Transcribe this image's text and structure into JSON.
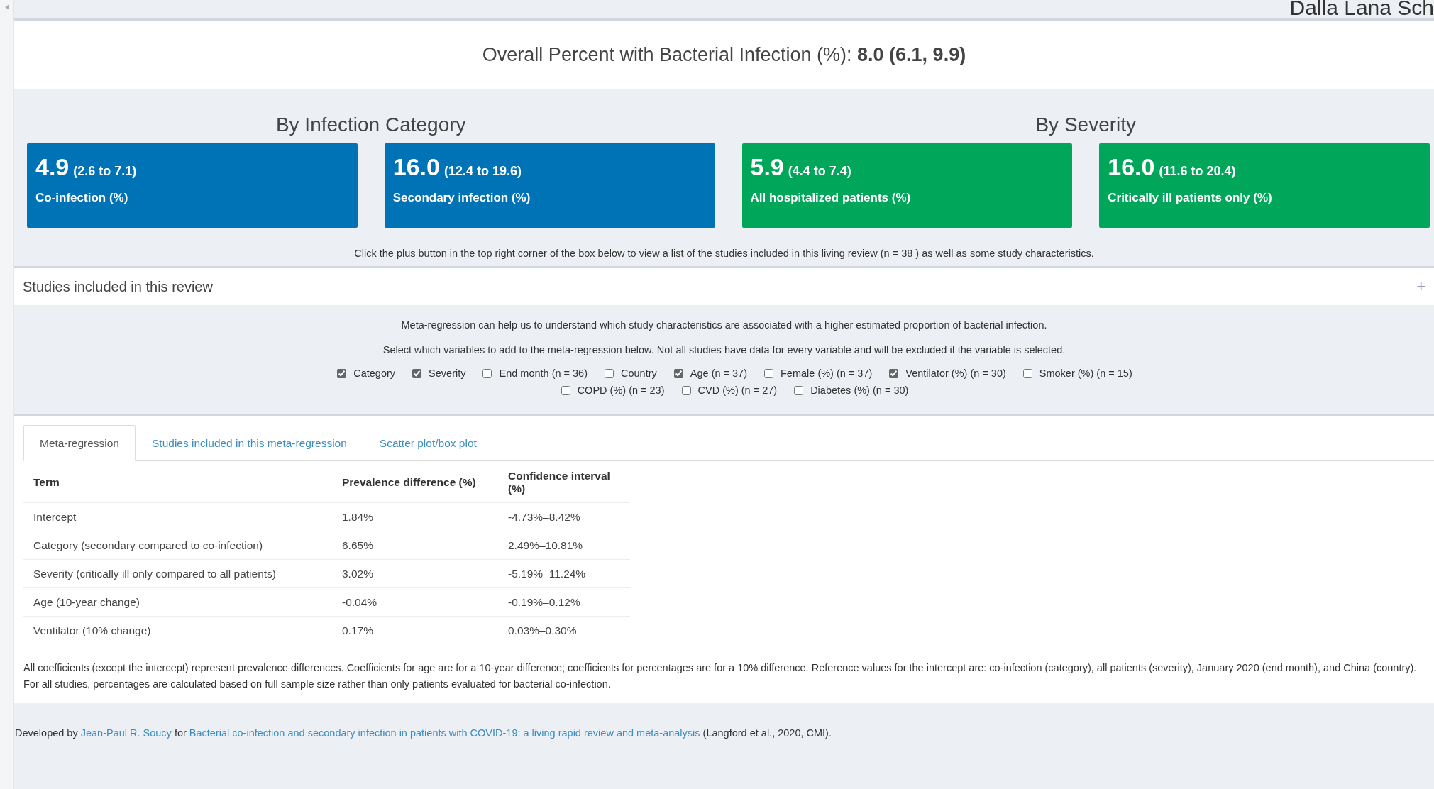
{
  "header_fragment": "Dalla Lana Sch",
  "overall": "Overall Percent with Bacterial Infection (%): **8.0 (6.1, 9.9)**",
  "groups": [
    {
      "title": "By Infection Category",
      "color": "#0073b7",
      "boxes": [
        {
          "value": "4.9",
          "range": "(2.6 to 7.1)",
          "label": "Co-infection (%)"
        },
        {
          "value": "16.0",
          "range": "(12.4 to 19.6)",
          "label": "Secondary infection (%)"
        }
      ]
    },
    {
      "title": "By Severity",
      "color": "#00a65a",
      "boxes": [
        {
          "value": "5.9",
          "range": "(4.4 to 7.4)",
          "label": "All hospitalized patients (%)"
        },
        {
          "value": "16.0",
          "range": "(11.6 to 20.4)",
          "label": "Critically ill patients only (%)"
        }
      ]
    }
  ],
  "note": "Click the plus button in the top right corner of the box below to view a list of the studies included in this living review (n = 38 ) as well as some study characteristics.",
  "collapsible": {
    "title": "Studies included in this review",
    "toggle": "+"
  },
  "info_lines": [
    "Meta-regression can help us to understand which study characteristics are associated with a higher estimated proportion of bacterial infection.",
    "Select which variables to add to the meta-regression below. Not all studies have data for every variable and will be excluded if the variable is selected."
  ],
  "variables": [
    {
      "label": "Category",
      "checked": true
    },
    {
      "label": "Severity",
      "checked": true
    },
    {
      "label": "End month (n = 36)",
      "checked": false
    },
    {
      "label": "Country",
      "checked": false
    },
    {
      "label": "Age (n = 37)",
      "checked": true
    },
    {
      "label": "Female (%) (n = 37)",
      "checked": false
    },
    {
      "label": "Ventilator (%) (n = 30)",
      "checked": true
    },
    {
      "label": "Smoker (%) (n = 15)",
      "checked": false
    },
    {
      "label": "COPD (%) (n = 23)",
      "checked": false
    },
    {
      "label": "CVD (%) (n = 27)",
      "checked": false
    },
    {
      "label": "Diabetes (%) (n = 30)",
      "checked": false
    }
  ],
  "tabs": [
    {
      "label": "Meta-regression",
      "selected": true
    },
    {
      "label": "Studies included in this meta-regression",
      "selected": false
    },
    {
      "label": "Scatter plot/box plot",
      "selected": false
    }
  ],
  "table": {
    "columns": [
      "Term",
      "Prevalence difference (%)",
      "Confidence interval (%)"
    ],
    "rows": [
      [
        "Intercept",
        "1.84%",
        "-4.73%–8.42%"
      ],
      [
        "Category (secondary compared to co-infection)",
        "6.65%",
        "2.49%–10.81%"
      ],
      [
        "Severity (critically ill only compared to all patients)",
        "3.02%",
        "-5.19%–11.24%"
      ],
      [
        "Age (10-year change)",
        "-0.04%",
        "-0.19%–0.12%"
      ],
      [
        "Ventilator (10% change)",
        "0.17%",
        "0.03%–0.30%"
      ]
    ]
  },
  "footnote": "All coefficients (except the intercept) represent prevalence differences. Coefficients for age are for a 10-year difference; coefficients for percentages are for a 10% difference. Reference values for the intercept are: co-infection (category), all patients (severity), January 2020 (end month), and China (country). For all studies, percentages are calculated based on full sample size rather than only patients evaluated for bacterial co-infection.",
  "footer": [
    {
      "kind": "text",
      "text": "Developed by "
    },
    {
      "kind": "link",
      "text": "Jean-Paul R. Soucy"
    },
    {
      "kind": "text",
      "text": " for "
    },
    {
      "kind": "link",
      "text": "Bacterial co-infection and secondary infection in patients with COVID-19: a living rapid review and meta-analysis"
    },
    {
      "kind": "text",
      "text": " (Langford et al., 2020, CMI)."
    }
  ]
}
